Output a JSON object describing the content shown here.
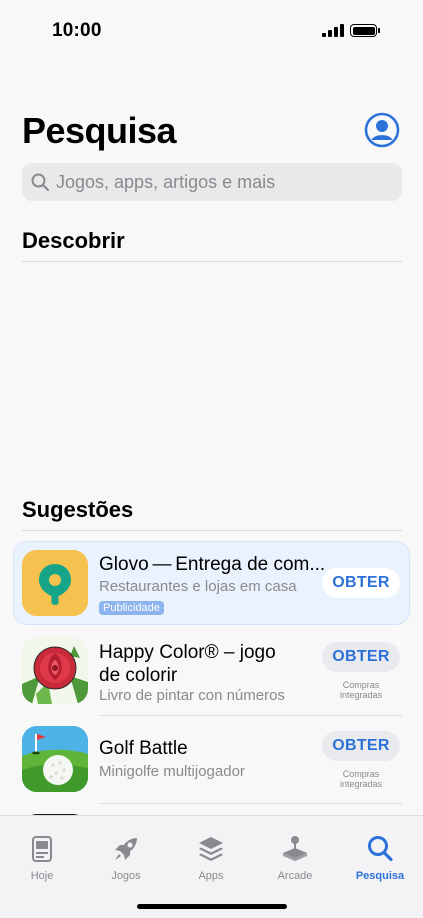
{
  "status_bar": {
    "time": "10:00"
  },
  "header": {
    "title": "Pesquisa",
    "account_icon": "person-circle-icon"
  },
  "search": {
    "placeholder": "Jogos, apps, artigos e mais",
    "value": ""
  },
  "sections": {
    "discover": "Descobrir",
    "suggestions": "Sugestões"
  },
  "apps": [
    {
      "name": "Glovo — Entrega de com...",
      "subtitle": "Restaurantes e lojas em casa",
      "badge": "Publicidade",
      "button": "OBTER",
      "icon": "glovo-pin-icon"
    },
    {
      "name": "Happy Color® – jogo de colorir",
      "subtitle": "Livro de pintar con números",
      "button": "OBTER",
      "note": "Compras integradas",
      "icon": "rose-coloring-icon"
    },
    {
      "name": "Golf Battle",
      "subtitle": "Minigolfe multijogador",
      "button": "OBTER",
      "note": "Compras integradas",
      "icon": "golf-ball-icon"
    }
  ],
  "tabs": [
    {
      "label": "Hoje",
      "icon": "today-icon"
    },
    {
      "label": "Jogos",
      "icon": "rocket-icon"
    },
    {
      "label": "Apps",
      "icon": "layers-icon"
    },
    {
      "label": "Arcade",
      "icon": "joystick-icon"
    },
    {
      "label": "Pesquisa",
      "icon": "search-icon",
      "active": true
    }
  ],
  "colors": {
    "accent": "#2c72d9",
    "background": "#f8f8f9",
    "ad_highlight": "#eaf2fd"
  }
}
